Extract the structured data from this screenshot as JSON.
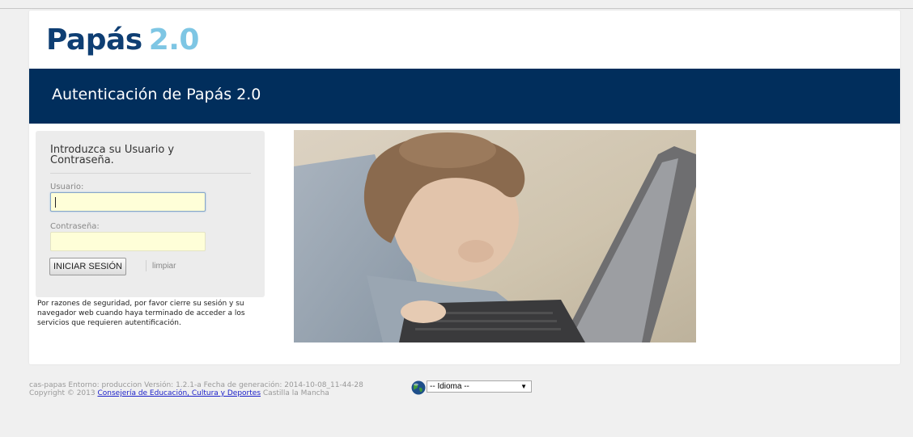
{
  "logo": {
    "brand": "Papás",
    "version": "2.0"
  },
  "banner": {
    "title": "Autenticación de Papás 2.0"
  },
  "login": {
    "heading": "Introduzca su Usuario y Contraseña.",
    "username_label": "Usuario:",
    "username_value": "",
    "password_label": "Contraseña:",
    "password_value": "",
    "submit_label": "INICIAR SESIÓN",
    "clear_label": "limpiar"
  },
  "notice": "Por razones de seguridad, por favor cierre su sesión y su navegador web cuando haya terminado de acceder a los servicios que requieren autentificación.",
  "footer": {
    "line1": "cas-papas Entorno: produccion Versión: 1.2.1-a Fecha de generación: 2014-10-08_11-44-28",
    "copyright_prefix": "Copyright © 2013",
    "org_link": "Consejería de Educación, Cultura y Deportes",
    "region": "Castilla la Mancha"
  },
  "language": {
    "selected": "-- Idioma --"
  },
  "colors": {
    "banner": "#012e5c",
    "logo_brand": "#0e3e73",
    "logo_version": "#7ec6e4",
    "input_bg": "#fefed8"
  },
  "icons": {
    "globe": "globe-icon",
    "dropdown": "chevron-down-icon"
  }
}
